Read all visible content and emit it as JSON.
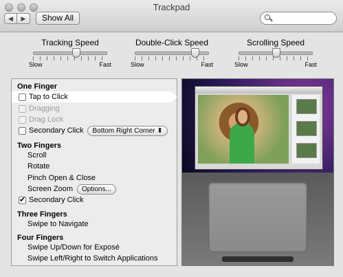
{
  "window": {
    "title": "Trackpad"
  },
  "toolbar": {
    "back_icon": "◀",
    "forward_icon": "▶",
    "show_all": "Show All",
    "search_value": ""
  },
  "sliders": [
    {
      "label": "Tracking Speed",
      "min": "Slow",
      "max": "Fast",
      "position": 0.53
    },
    {
      "label": "Double-Click Speed",
      "min": "Slow",
      "max": "Fast",
      "position": 0.8
    },
    {
      "label": "Scrolling Speed",
      "min": "Slow",
      "max": "Fast",
      "position": 0.45
    }
  ],
  "sections": {
    "one_finger": "One Finger",
    "two_fingers": "Two Fingers",
    "three_fingers": "Three Fingers",
    "four_fingers": "Four Fingers"
  },
  "options": {
    "tap_to_click": "Tap to Click",
    "dragging": "Dragging",
    "drag_lock": "Drag Lock",
    "secondary_click_1": "Secondary Click",
    "secondary_click_popup": "Bottom Right Corner",
    "scroll": "Scroll",
    "rotate": "Rotate",
    "pinch": "Pinch Open & Close",
    "screen_zoom": "Screen Zoom",
    "options_button": "Options...",
    "secondary_click_2": "Secondary Click",
    "swipe_navigate": "Swipe to Navigate",
    "swipe_expose": "Swipe Up/Down for Exposé",
    "swipe_switch": "Swipe Left/Right to Switch Applications"
  }
}
